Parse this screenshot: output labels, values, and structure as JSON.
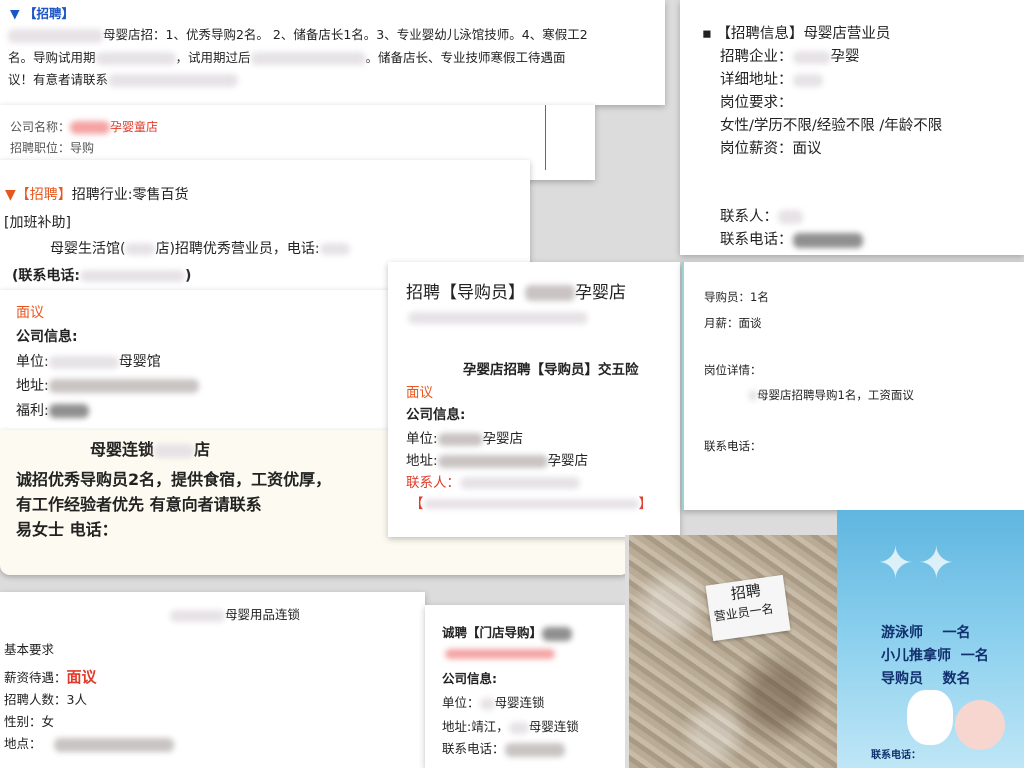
{
  "c1": {
    "header": "【招聘】",
    "line1": "母婴店招：1、优秀导购2名。 2、储备店长1名。3、专业婴幼儿泳馆技师。4、寒假工2",
    "line2a": "名。导购试用期",
    "line2b": "，试用期过后",
    "line2c": "。储备店长、专业技师寒假工待遇面",
    "line3": "议！有意者请联系"
  },
  "c2": {
    "company_label": "公司名称：",
    "company_value": "孕婴童店",
    "position_label": "招聘职位：",
    "position_value": "导购"
  },
  "c3": {
    "header_tag": "【招聘】",
    "header_rest": "招聘行业:零售百货",
    "line1": "[加班补助]",
    "line2a": "母婴生活馆(",
    "line2b": "店)招聘优秀营业员，电话:",
    "line3a": "(联系电话:",
    "line3b": ")"
  },
  "c4": {
    "salary": "面议",
    "company_info": "公司信息:",
    "unit_label": "单位:",
    "unit_value": "母婴馆",
    "addr_label": "地址:",
    "welfare_label": "福利:"
  },
  "c5": {
    "line0a": "母婴连锁",
    "line0b": "店",
    "line1": "诚招优秀导购员2名，提供食宿，工资优厚，",
    "line2": "有工作经验者优先 有意向者请联系",
    "line3": "易女士 电话："
  },
  "c6": {
    "title_a": "招聘【导购员】",
    "title_b": "孕婴店",
    "line1": "孕婴店招聘【导购员】交五险",
    "salary": "面议",
    "company_info": "公司信息:",
    "unit_label": "单位:",
    "unit_value": "孕婴店",
    "addr_label": "地址:",
    "addr_value": "孕婴店",
    "contact_label": "联系人：",
    "bracket_l": "【",
    "bracket_r": "】"
  },
  "c7": {
    "bullet": "▪",
    "title_tag": "【招聘信息】",
    "title_rest": "母婴店营业员",
    "company_label": "招聘企业：",
    "company_value": "孕婴",
    "addr_label": "详细地址：",
    "req_label": "岗位要求：",
    "req_value": "女性/学历不限/经验不限 /年龄不限",
    "pay": "岗位薪资：面议",
    "contact_label": "联系人：",
    "phone_label": "联系电话："
  },
  "c8": {
    "count": "导购员：1名",
    "pay": "月薪：面谈",
    "detail_label": "岗位详情：",
    "detail_value": "母婴店招聘导购1名，工资面议",
    "phone_label": "联系电话："
  },
  "c9": {
    "header": "母婴用品连锁",
    "basic": "基本要求",
    "pay_label": "薪资待遇：",
    "pay_value": "面议",
    "count": "招聘人数：3人",
    "gender": "性别：女",
    "place_label": "地点："
  },
  "c10": {
    "title": "诚聘【门店导购】",
    "company_info": "公司信息:",
    "unit_label": "单位：",
    "unit_value": "母婴连锁",
    "addr_label": "地址:靖江，",
    "addr_value": "母婴连锁",
    "phone_label": "联系电话："
  },
  "p1": {
    "note1": "招聘",
    "note2": "营业员一名"
  },
  "p2": {
    "row1a": "游泳师",
    "row1b": "一名",
    "row2a": "小儿推拿师",
    "row2b": "一名",
    "row3a": "导购员",
    "row3b": "数名",
    "tel": "联系电话："
  }
}
